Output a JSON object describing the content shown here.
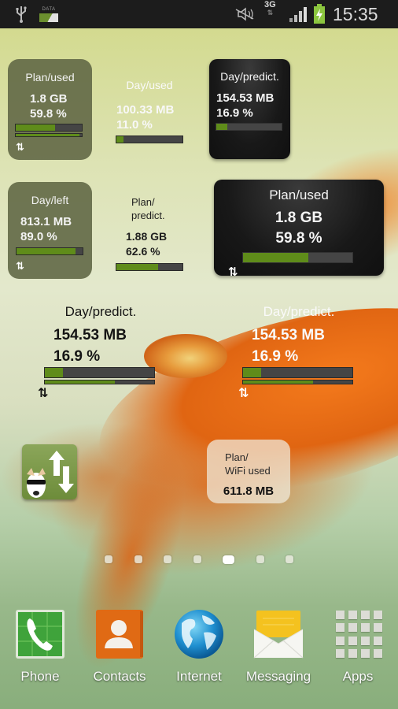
{
  "status_bar": {
    "icons": [
      "usb-icon",
      "data-icon",
      "mute-icon",
      "network-3g-icon",
      "signal-icon",
      "battery-charging-icon"
    ],
    "data_label": "DATA",
    "network_label": "3G",
    "time": "15:35"
  },
  "widgets": [
    {
      "id": "plan-used-gray",
      "title": "Plan/used",
      "value": "1.8 GB",
      "percent": "59.8 %",
      "bar_fraction": 0.598,
      "second_bar_fraction": 0.97,
      "arrows": "⇅"
    },
    {
      "id": "day-used-transparent",
      "title": "Day/used",
      "value": "100.33 MB",
      "percent": "11.0 %",
      "bar_fraction": 0.11
    },
    {
      "id": "day-predict-black",
      "title": "Day/predict.",
      "value": "154.53 MB",
      "percent": "16.9 %",
      "bar_fraction": 0.169
    },
    {
      "id": "day-left-gray",
      "title": "Day/left",
      "value": "813.1 MB",
      "percent": "89.0 %",
      "bar_fraction": 0.89,
      "arrows": "⇅"
    },
    {
      "id": "plan-predict-transparent",
      "title_line1": "Plan/",
      "title_line2": "predict.",
      "value": "1.88 GB",
      "percent": "62.6 %",
      "bar_fraction": 0.626
    },
    {
      "id": "plan-used-black-large",
      "title": "Plan/used",
      "value": "1.8 GB",
      "percent": "59.8 %",
      "bar_fraction": 0.598,
      "arrows": "⇅"
    },
    {
      "id": "day-predict-dark-text",
      "title": "Day/predict.",
      "value": "154.53 MB",
      "percent": "16.9 %",
      "bar_fraction": 0.169,
      "second_bar_fraction": 0.64,
      "arrows": "⇅"
    },
    {
      "id": "day-predict-white-text",
      "title": "Day/predict.",
      "value": "154.53 MB",
      "percent": "16.9 %",
      "bar_fraction": 0.169,
      "second_bar_fraction": 0.64,
      "arrows": "⇅"
    },
    {
      "id": "plan-wifi-used",
      "title_line1": "Plan/",
      "title_line2": "WiFi used",
      "value": "611.8 MB"
    }
  ],
  "app_shortcut": {
    "name": "3G Watchdog",
    "icon": "3g-watchdog-icon"
  },
  "pager": {
    "pages": 7,
    "active_index": 4
  },
  "dock": [
    {
      "label": "Phone",
      "icon": "phone-icon"
    },
    {
      "label": "Contacts",
      "icon": "contacts-icon"
    },
    {
      "label": "Internet",
      "icon": "globe-icon"
    },
    {
      "label": "Messaging",
      "icon": "envelope-icon"
    },
    {
      "label": "Apps",
      "icon": "apps-grid-icon"
    }
  ],
  "colors": {
    "bar_fill": "#5f8c1a",
    "bar_track": "#454545",
    "statusbar_bg": "#1c1c1c",
    "battery": "#8cc63f"
  }
}
